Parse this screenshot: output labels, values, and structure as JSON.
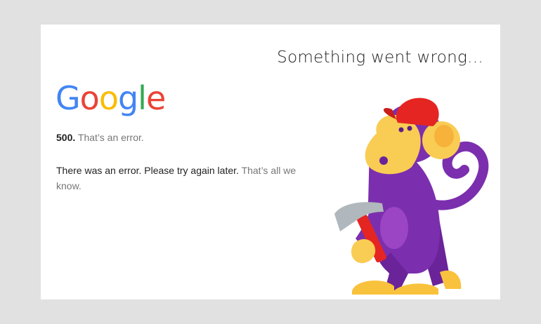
{
  "headline": "Something went wrong...",
  "logo": {
    "letters": [
      "G",
      "o",
      "o",
      "g",
      "l",
      "e"
    ],
    "colors": [
      "#4285F4",
      "#EA4335",
      "#FBBC05",
      "#4285F4",
      "#34A853",
      "#EA4335"
    ]
  },
  "error": {
    "code": "500.",
    "short": "That’s an error.",
    "message": "There was an error. Please try again later.",
    "suffix": "That’s all we know."
  },
  "colors": {
    "background": "#e1e1e1",
    "card": "#ffffff",
    "monkey_body": "#7b2fae",
    "monkey_face": "#f9cc53",
    "cap": "#e52521",
    "hammer_handle": "#e52521",
    "hammer_head": "#b0b8bd"
  },
  "illustration": {
    "icon": "monkey-with-hammer-icon"
  }
}
